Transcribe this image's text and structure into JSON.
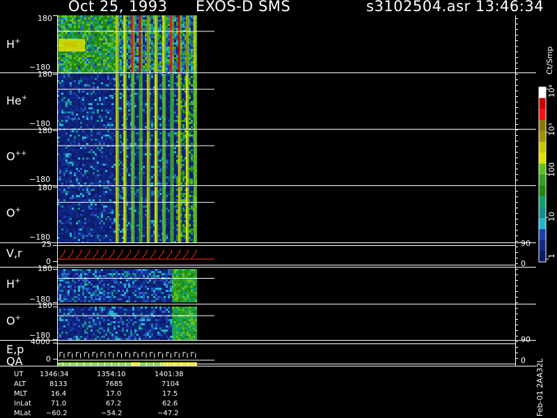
{
  "header": {
    "date": "Oct 25, 1993",
    "instrument": "EXOS-D SMS",
    "file_time": "s3102504.asr  13:46:34"
  },
  "panels": [
    {
      "id": "h1",
      "ion": "H",
      "sup": "+",
      "top_tick": "180",
      "bot_tick": "−180"
    },
    {
      "id": "he",
      "ion": "He",
      "sup": "+",
      "top_tick": "180",
      "bot_tick": "−180"
    },
    {
      "id": "opp",
      "ion": "O",
      "sup": "++",
      "top_tick": "180",
      "bot_tick": "−180"
    },
    {
      "id": "o1",
      "ion": "O",
      "sup": "+",
      "top_tick": "180",
      "bot_tick": "−180"
    },
    {
      "id": "vr",
      "ion": "V,r",
      "sup": "",
      "top_tick": "25",
      "bot_tick": "0",
      "right_top": "90",
      "right_bot": "0"
    },
    {
      "id": "h2",
      "ion": "H",
      "sup": "+",
      "top_tick": "180",
      "bot_tick": "−180"
    },
    {
      "id": "o2",
      "ion": "O",
      "sup": "+",
      "top_tick": "180",
      "bot_tick": "−180"
    },
    {
      "id": "ep",
      "ion": "E,p",
      "sup": "",
      "top_tick": "4000",
      "bot_tick": "0",
      "right_top": "90",
      "right_bot": "0"
    }
  ],
  "qa_label": "QA",
  "colorbar": {
    "unit": "Ct/Smp",
    "labels": [
      "1",
      "10",
      "100",
      "10³",
      "10⁴"
    ],
    "colors": [
      "#ffffff",
      "#d00000",
      "#ff1010",
      "#8a7a00",
      "#a09000",
      "#c8c800",
      "#e0e000",
      "#60c020",
      "#30a020",
      "#208810",
      "#10a070",
      "#0f8f8f",
      "#20b8d0",
      "#1a3fb0",
      "#122a8a",
      "#0b1a6a"
    ]
  },
  "ephemeris": {
    "rows": [
      "UT",
      "ALT",
      "MLT",
      "InLat",
      "MLat"
    ],
    "columns": [
      [
        "1346:34",
        "8133",
        "16.4",
        "71.0",
        "−60.2"
      ],
      [
        "1354:10",
        "7685",
        "17.0",
        "67.2",
        "−54.2"
      ],
      [
        "1401:38",
        "7104",
        "17.5",
        "62.6",
        "−47.2"
      ]
    ]
  },
  "footer": "Feb-01 2AA32L"
}
